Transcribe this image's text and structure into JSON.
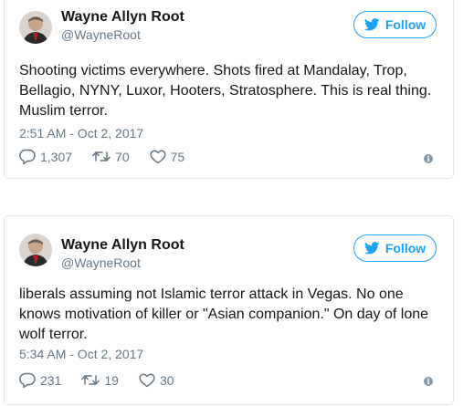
{
  "colors": {
    "accent": "#1da1f2",
    "muted": "#657786",
    "text": "#14171a",
    "border": "#e1e8ed"
  },
  "tweets": [
    {
      "name": "Wayne Allyn Root",
      "handle": "@WayneRoot",
      "follow_label": "Follow",
      "text": "Shooting victims everywhere. Shots fired at Mandalay, Trop, Bellagio, NYNY, Luxor, Hooters, Stratosphere. This is real thing. Muslim terror.",
      "timestamp": "2:51 AM - Oct 2, 2017",
      "replies": "1,307",
      "retweets": "70",
      "likes": "75",
      "icons": [
        "avatar",
        "twitter-bird-icon",
        "reply-icon",
        "retweet-icon",
        "heart-icon",
        "info-icon"
      ]
    },
    {
      "name": "Wayne Allyn Root",
      "handle": "@WayneRoot",
      "follow_label": "Follow",
      "text": "liberals assuming not Islamic terror attack in Vegas. No one knows motivation of killer or \"Asian companion.\" On day of lone wolf terror.",
      "timestamp": "5:34 AM - Oct 2, 2017",
      "replies": "231",
      "retweets": "19",
      "likes": "30",
      "icons": [
        "avatar",
        "twitter-bird-icon",
        "reply-icon",
        "retweet-icon",
        "heart-icon",
        "info-icon"
      ]
    }
  ]
}
